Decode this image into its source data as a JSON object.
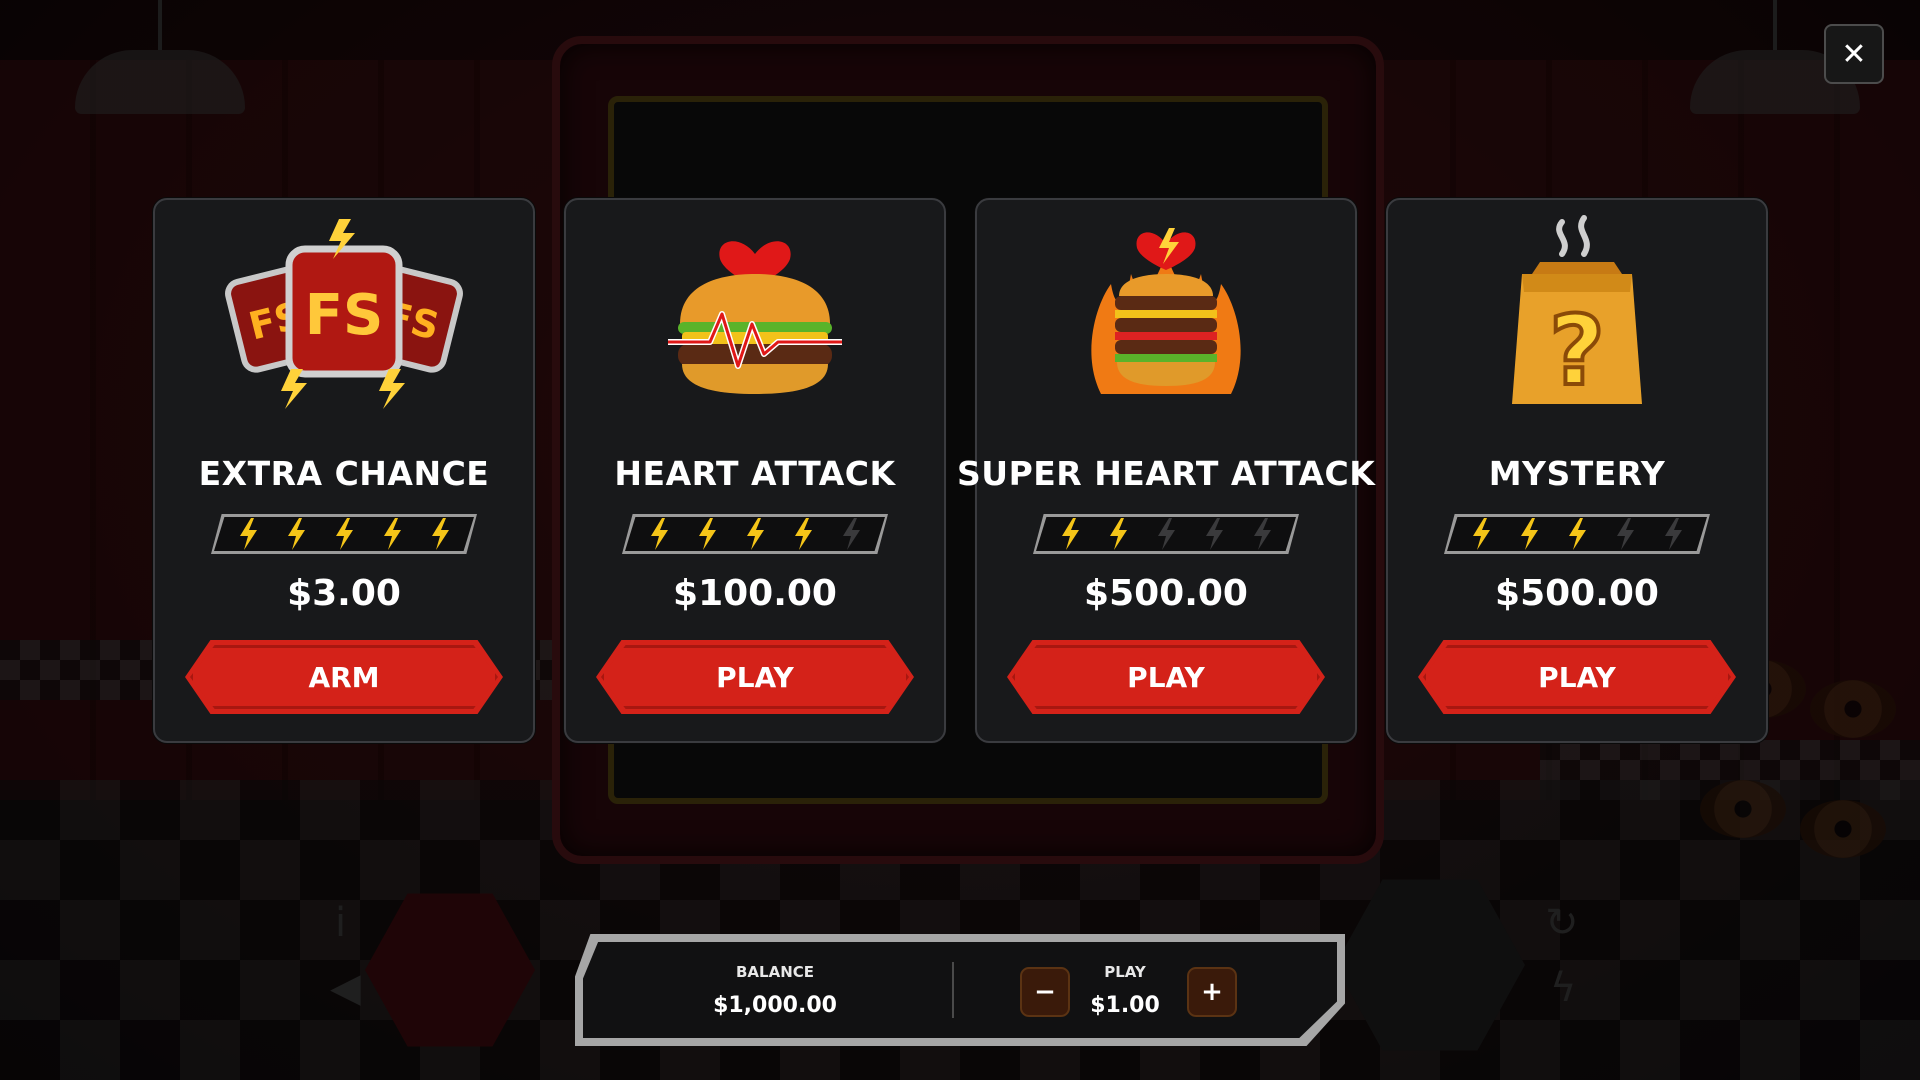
{
  "close_label": "✕",
  "cards": [
    {
      "title": "EXTRA CHANCE",
      "price": "$3.00",
      "button": "ARM",
      "bolts_on": 5,
      "bolts_total": 5,
      "image": "extra-chance-fs-badge"
    },
    {
      "title": "HEART ATTACK",
      "price": "$100.00",
      "button": "PLAY",
      "bolts_on": 4,
      "bolts_total": 5,
      "image": "burger-heartbeat"
    },
    {
      "title": "SUPER HEART ATTACK",
      "price": "$500.00",
      "button": "PLAY",
      "bolts_on": 2,
      "bolts_total": 5,
      "image": "flaming-stacked-burger"
    },
    {
      "title": "MYSTERY",
      "price": "$500.00",
      "button": "PLAY",
      "bolts_on": 3,
      "bolts_total": 5,
      "image": "mystery-paper-bag"
    }
  ],
  "bottom_bar": {
    "balance_label": "BALANCE",
    "balance_value": "$1,000.00",
    "play_label": "PLAY",
    "play_value": "$1.00",
    "minus_label": "−",
    "plus_label": "+"
  },
  "colors": {
    "button_red": "#d42219",
    "bolt_on": "#f5c518",
    "bolt_off": "#3a3a3c",
    "card_bg": "#18191b"
  }
}
